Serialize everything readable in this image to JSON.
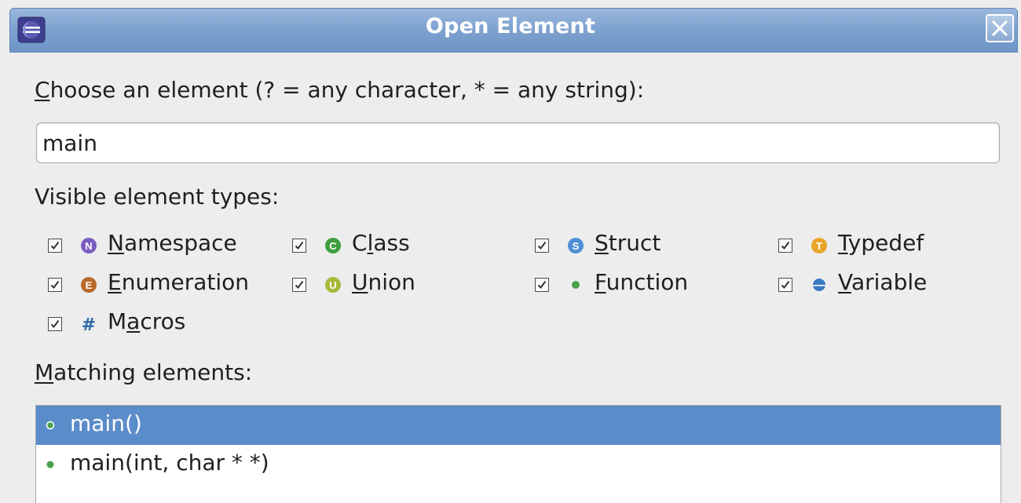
{
  "window": {
    "title": "Open Element",
    "app_icon": "eclipse-icon",
    "close_icon": "close-icon"
  },
  "prompt": {
    "pre": "",
    "mnemonic": "C",
    "post": "hoose an element (? = any character, * = any string):"
  },
  "search": {
    "value": "main"
  },
  "types_label": "Visible element types:",
  "filters": [
    {
      "pre": "",
      "mnemonic": "N",
      "post": "amespace",
      "checked": true,
      "icon": "namespace-icon",
      "color": "#7b5cc0"
    },
    {
      "pre": "C",
      "mnemonic": "l",
      "post": "ass",
      "checked": true,
      "icon": "class-icon",
      "color": "#3f9e3f"
    },
    {
      "pre": "",
      "mnemonic": "S",
      "post": "truct",
      "checked": true,
      "icon": "struct-icon",
      "color": "#4f8fd6"
    },
    {
      "pre": "",
      "mnemonic": "T",
      "post": "ypedef",
      "checked": true,
      "icon": "typedef-icon",
      "color": "#e8a52a"
    },
    {
      "pre": "",
      "mnemonic": "E",
      "post": "numeration",
      "checked": true,
      "icon": "enumeration-icon",
      "color": "#b9692a"
    },
    {
      "pre": "",
      "mnemonic": "U",
      "post": "nion",
      "checked": true,
      "icon": "union-icon",
      "color": "#a8b93a"
    },
    {
      "pre": "",
      "mnemonic": "F",
      "post": "unction",
      "checked": true,
      "icon": "function-icon",
      "color": "#4aa04a"
    },
    {
      "pre": "",
      "mnemonic": "V",
      "post": "ariable",
      "checked": true,
      "icon": "variable-icon",
      "color": "#3a78c2"
    },
    {
      "pre": "M",
      "mnemonic": "a",
      "post": "cros",
      "checked": true,
      "icon": "macro-icon",
      "color": "#2f6aa8"
    }
  ],
  "matching": {
    "pre": "",
    "mnemonic": "M",
    "post": "atching elements:"
  },
  "results": [
    {
      "label": "main()",
      "selected": true,
      "icon": "function-icon"
    },
    {
      "label": "main(int, char * *)",
      "selected": false,
      "icon": "function-icon"
    }
  ],
  "colors": {
    "selection": "#5b8cca",
    "titlebar": "#7fa3d0",
    "function_green": "#4aa04a"
  }
}
